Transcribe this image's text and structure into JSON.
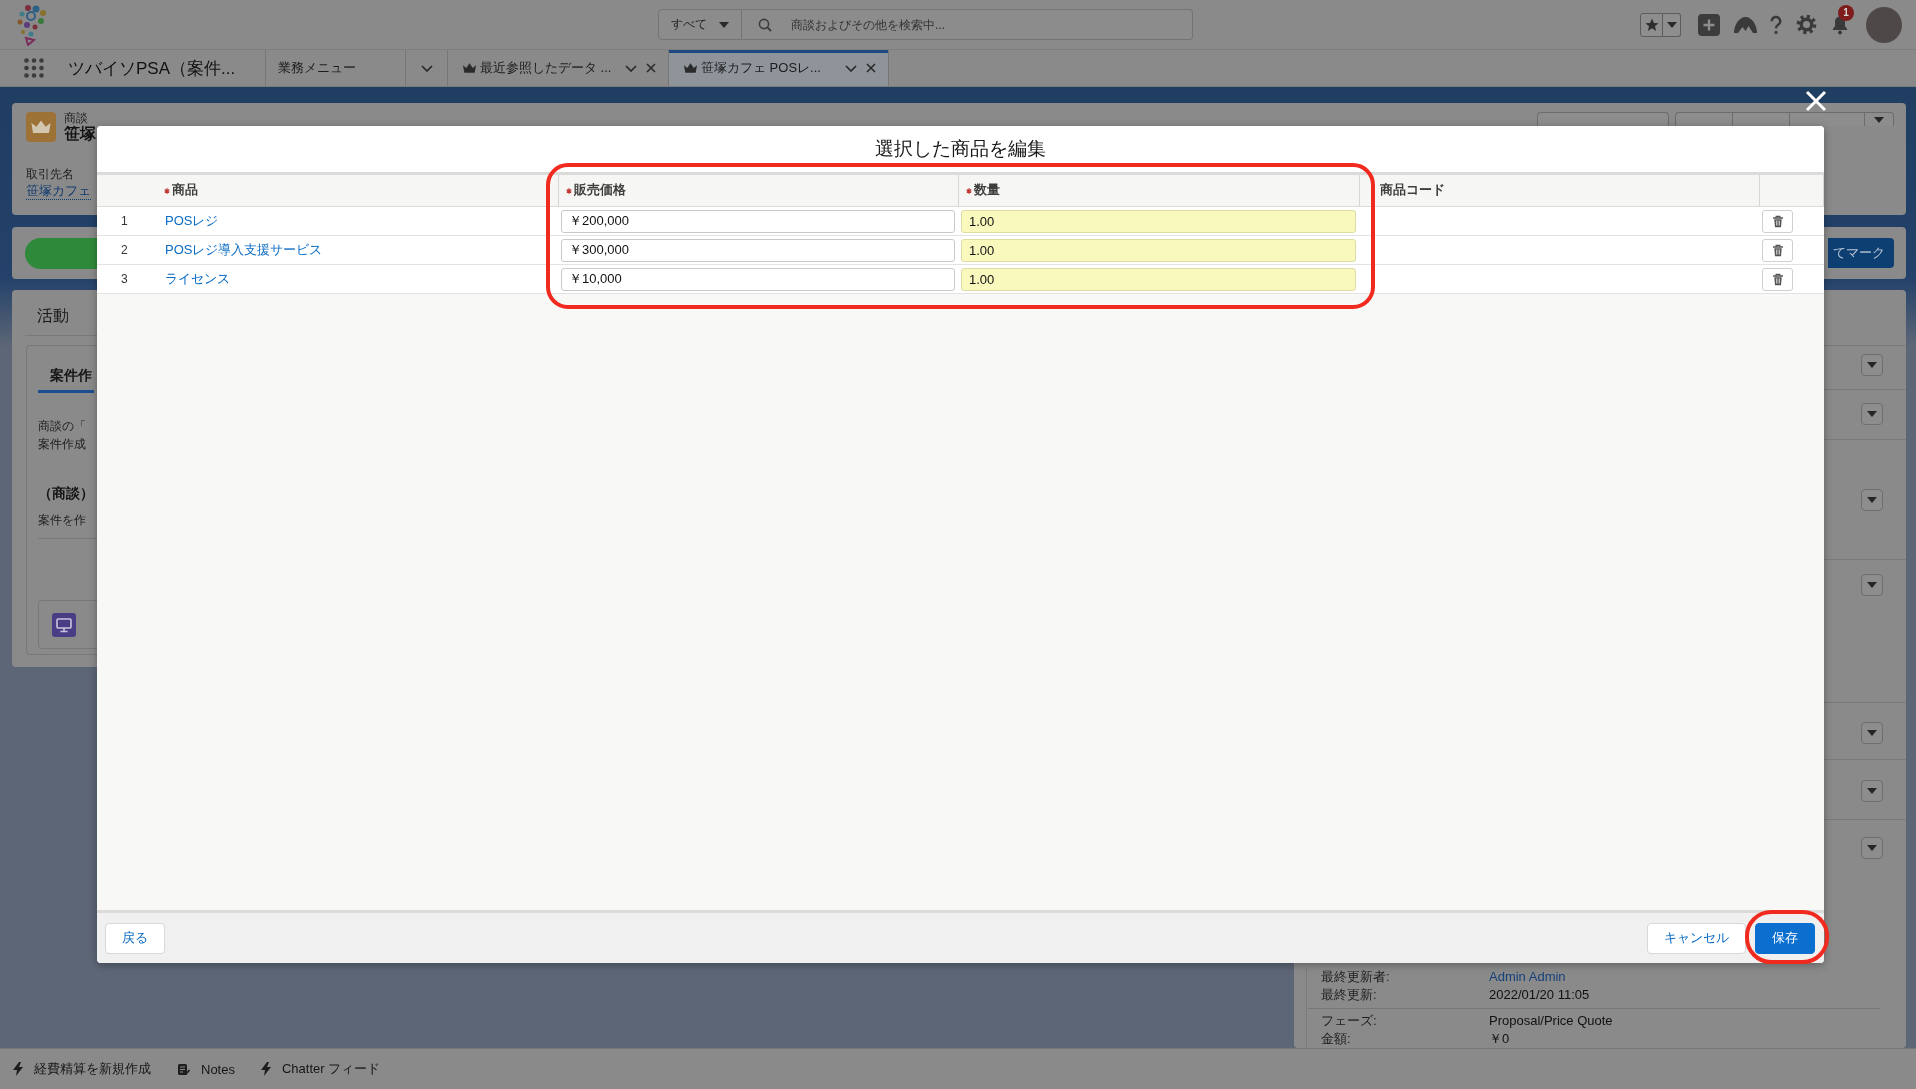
{
  "global_header": {
    "search_scope": "すべて",
    "search": {
      "placeholder": "商談およびその他を検索中..."
    },
    "notification_count": "1"
  },
  "nav": {
    "app_name": "ツバイソPSA（案件...",
    "tabs": [
      {
        "label": "業務メニュー",
        "kind": "menu",
        "selected": false
      },
      {
        "label": "最近参照したデータ ...",
        "kind": "record",
        "selected": false
      },
      {
        "label": "笹塚カフェ POSレ...",
        "kind": "record",
        "selected": true
      }
    ]
  },
  "record": {
    "object_label": "商談",
    "title": "笹塚",
    "fields": [
      {
        "label": "取引先名",
        "value": "笹塚カフェ"
      }
    ],
    "path_action": "てマーク"
  },
  "activity": {
    "title": "活動",
    "tab": "案件作",
    "lines": [
      "商談の「",
      "案件作成"
    ],
    "heading": "（商談）",
    "note": "案件を作"
  },
  "details": {
    "sections": [
      {
        "rows": [
          {
            "label": "最終更新者:",
            "value": "Admin Admin",
            "kind": "link"
          },
          {
            "label": "最終更新:",
            "value": "2022/01/20 11:05",
            "kind": "text"
          }
        ]
      },
      {
        "rows": [
          {
            "label": "フェーズ:",
            "value": "Proposal/Price Quote",
            "kind": "text"
          },
          {
            "label": "金額:",
            "value": "￥0",
            "kind": "text"
          }
        ]
      }
    ]
  },
  "modal": {
    "title": "選択した商品を編集",
    "columns": [
      {
        "label": "商品",
        "required": true,
        "circled": false
      },
      {
        "label": "販売価格",
        "required": true,
        "circled": true
      },
      {
        "label": "数量",
        "required": true,
        "circled": true
      },
      {
        "label": "商品コード",
        "required": false,
        "circled": false
      }
    ],
    "rows": [
      {
        "number": "1",
        "product": "POSレジ",
        "price": {
          "value": "￥200,000",
          "highlighted": false
        },
        "quantity": {
          "value": "1.00",
          "highlighted": true
        }
      },
      {
        "number": "2",
        "product": "POSレジ導入支援サービス",
        "price": {
          "value": "￥300,000",
          "highlighted": false
        },
        "quantity": {
          "value": "1.00",
          "highlighted": true
        }
      },
      {
        "number": "3",
        "product": "ライセンス",
        "price": {
          "value": "￥10,000",
          "highlighted": false
        },
        "quantity": {
          "value": "1.00",
          "highlighted": true
        }
      }
    ],
    "buttons": [
      {
        "label": "戻る",
        "kind": "back",
        "circled": false
      },
      {
        "label": "キャンセル",
        "kind": "cancel",
        "circled": false
      },
      {
        "label": "保存",
        "kind": "save",
        "circled": true
      }
    ]
  },
  "utility_bar": [
    {
      "label": "経費精算を新規作成",
      "kind": "action"
    },
    {
      "label": "Notes",
      "kind": "notes"
    },
    {
      "label": "Chatter フィード",
      "kind": "action"
    }
  ]
}
